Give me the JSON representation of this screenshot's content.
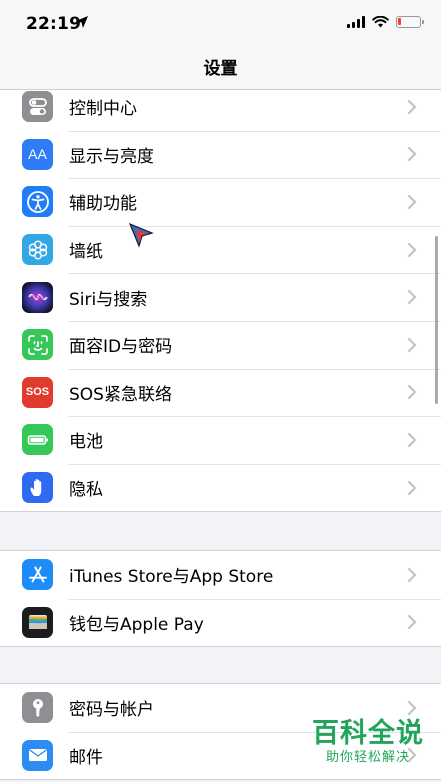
{
  "status_bar": {
    "time": "22:19",
    "location_icon": "location-arrow-icon",
    "signal_icon": "cellular-signal-icon",
    "wifi_icon": "wifi-icon",
    "battery_icon": "battery-low-icon",
    "battery_level_fraction": 0.1,
    "battery_color": "#ff3b30"
  },
  "nav": {
    "title": "设置"
  },
  "groups": [
    {
      "items": [
        {
          "label": "控制中心",
          "icon": "control-center-icon",
          "color": "#8e8e93"
        },
        {
          "label": "显示与亮度",
          "icon": "display-brightness-icon",
          "color": "#2f7cf6",
          "glyph": "AA"
        },
        {
          "label": "辅助功能",
          "icon": "accessibility-icon",
          "color": "#1e7df7"
        },
        {
          "label": "墙纸",
          "icon": "wallpaper-icon",
          "color": "#32a7e6"
        },
        {
          "label": "Siri与搜索",
          "icon": "siri-icon",
          "color": "#1c1c3c"
        },
        {
          "label": "面容ID与密码",
          "icon": "face-id-icon",
          "color": "#36c759"
        },
        {
          "label": "SOS紧急联络",
          "icon": "sos-icon",
          "color": "#e23a2e",
          "glyph": "SOS"
        },
        {
          "label": "电池",
          "icon": "battery-icon",
          "color": "#36c759"
        },
        {
          "label": "隐私",
          "icon": "privacy-hand-icon",
          "color": "#2f6bf2"
        }
      ]
    },
    {
      "items": [
        {
          "label": "iTunes Store与App Store",
          "icon": "app-store-icon",
          "color": "#1e8cf8"
        },
        {
          "label": "钱包与Apple Pay",
          "icon": "wallet-icon",
          "color": "#1c1c1e"
        }
      ]
    },
    {
      "items": [
        {
          "label": "密码与帐户",
          "icon": "key-icon",
          "color": "#8e8e93"
        },
        {
          "label": "邮件",
          "icon": "mail-icon",
          "color": "#2d8cf0"
        }
      ]
    }
  ],
  "watermark": {
    "main": "百科全说",
    "sub": "助你轻松解决",
    "color": "#22a45a"
  }
}
